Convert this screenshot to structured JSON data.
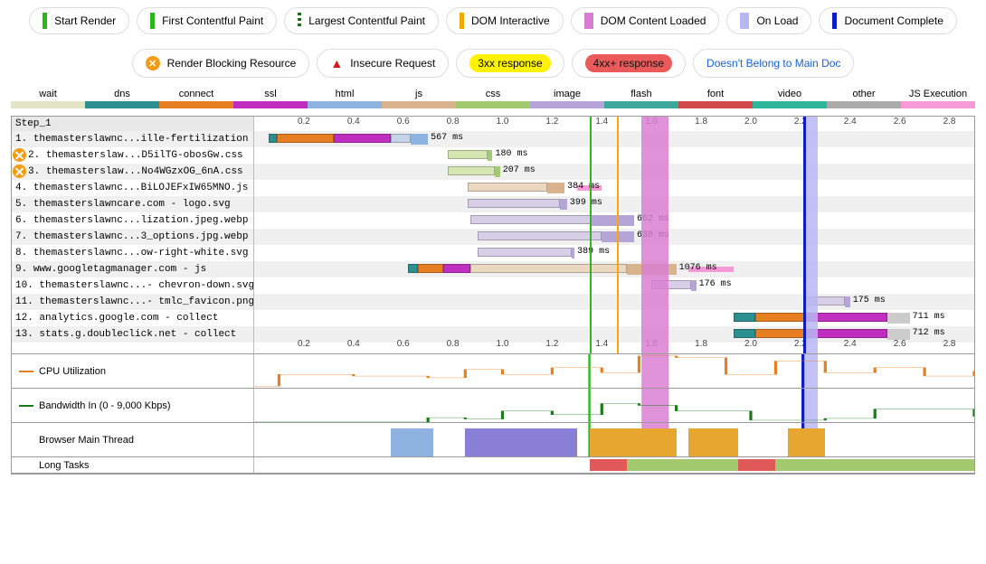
{
  "legend_timing": [
    {
      "name": "start-render",
      "label": "Start Render",
      "mark": "mark-start-render"
    },
    {
      "name": "fcp",
      "label": "First Contentful Paint",
      "mark": "mark-fcp"
    },
    {
      "name": "lcp",
      "label": "Largest Contentful Paint",
      "mark": "mark-lcp"
    },
    {
      "name": "dom-interactive",
      "label": "DOM Interactive",
      "mark": "mark-dom-int"
    },
    {
      "name": "dcl",
      "label": "DOM Content Loaded",
      "mark": "mark-dcl"
    },
    {
      "name": "onload",
      "label": "On Load",
      "mark": "mark-onload"
    },
    {
      "name": "doc-complete",
      "label": "Document Complete",
      "mark": "mark-doc"
    }
  ],
  "legend_status": {
    "render_blocking": "Render Blocking Resource",
    "insecure": "Insecure Request",
    "r3xx": "3xx response",
    "r4xx": "4xx+ response",
    "not_main": "Doesn't Belong to Main Doc"
  },
  "types": [
    {
      "label": "wait",
      "sw": "sw-wait"
    },
    {
      "label": "dns",
      "sw": "sw-dns"
    },
    {
      "label": "connect",
      "sw": "sw-connect"
    },
    {
      "label": "ssl",
      "sw": "sw-ssl"
    },
    {
      "label": "html",
      "sw": "sw-html"
    },
    {
      "label": "js",
      "sw": "sw-js"
    },
    {
      "label": "css",
      "sw": "sw-css"
    },
    {
      "label": "image",
      "sw": "sw-image"
    },
    {
      "label": "flash",
      "sw": "sw-flash"
    },
    {
      "label": "font",
      "sw": "sw-font"
    },
    {
      "label": "video",
      "sw": "sw-video"
    },
    {
      "label": "other",
      "sw": "sw-other"
    },
    {
      "label": "JS Execution",
      "sw": "sw-jse"
    }
  ],
  "step_label": "Step_1",
  "axis_ticks": [
    "0.2",
    "0.4",
    "0.6",
    "0.8",
    "1.0",
    "1.2",
    "1.4",
    "1.6",
    "1.8",
    "2.0",
    "2.2",
    "2.4",
    "2.6",
    "2.8"
  ],
  "requests": [
    {
      "n": 1,
      "label": "themasterslawnc...ille-fertilization",
      "blocking": false,
      "duration": "567 ms"
    },
    {
      "n": 2,
      "label": "themasterslaw...D5ilTG-obosGw.css",
      "blocking": true,
      "duration": "180 ms"
    },
    {
      "n": 3,
      "label": "themasterslaw...No4WGzxOG_6nA.css",
      "blocking": true,
      "duration": "207 ms"
    },
    {
      "n": 4,
      "label": "themasterslawnc...BiLOJEFxIW65MNO.js",
      "blocking": false,
      "duration": "384 ms"
    },
    {
      "n": 5,
      "label": "themasterslawncare.com - logo.svg",
      "blocking": false,
      "duration": "399 ms"
    },
    {
      "n": 6,
      "label": "themasterslawnc...lization.jpeg.webp",
      "blocking": false,
      "duration": "662 ms"
    },
    {
      "n": 7,
      "label": "themasterslawnc...3_options.jpg.webp",
      "blocking": false,
      "duration": "630 ms"
    },
    {
      "n": 8,
      "label": "themasterslawnc...ow-right-white.svg",
      "blocking": false,
      "duration": "389 ms"
    },
    {
      "n": 9,
      "label": "www.googletagmanager.com - js",
      "blocking": false,
      "duration": "1076 ms"
    },
    {
      "n": 10,
      "label": "themasterslawnc...- chevron-down.svg",
      "blocking": false,
      "duration": "176 ms"
    },
    {
      "n": 11,
      "label": "themasterslawnc...- tmlc_favicon.png",
      "blocking": false,
      "duration": "175 ms"
    },
    {
      "n": 12,
      "label": "analytics.google.com - collect",
      "blocking": false,
      "duration": "711 ms"
    },
    {
      "n": 13,
      "label": "stats.g.doubleclick.net - collect",
      "blocking": false,
      "duration": "712 ms"
    }
  ],
  "panels": {
    "cpu": "CPU Utilization",
    "bw": "Bandwidth In (0 - 9,000 Kbps)",
    "thread": "Browser Main Thread",
    "long": "Long Tasks"
  },
  "chart_data": {
    "type": "waterfall",
    "title": "",
    "x_unit": "seconds",
    "x_range": [
      0,
      2.9
    ],
    "timing_marks": {
      "start_render": 1.35,
      "first_contentful_paint": 1.35,
      "dom_interactive": 1.46,
      "dom_content_loaded": [
        1.56,
        1.67
      ],
      "on_load": [
        2.21,
        2.27
      ],
      "document_complete": 2.21
    },
    "requests": [
      {
        "n": 1,
        "name": "ille-fertilization (html)",
        "duration_ms": 567,
        "segments": [
          {
            "phase": "dns",
            "start": 0.06,
            "end": 0.09
          },
          {
            "phase": "connect",
            "start": 0.09,
            "end": 0.32
          },
          {
            "phase": "ssl",
            "start": 0.32,
            "end": 0.55
          },
          {
            "phase": "html",
            "start": 0.55,
            "end": 0.63
          },
          {
            "phase": "html_download",
            "start": 0.63,
            "end": 0.7,
            "solid": true
          }
        ]
      },
      {
        "n": 2,
        "name": "D5ilTG-obosGw.css",
        "duration_ms": 180,
        "render_blocking": true,
        "segments": [
          {
            "phase": "css",
            "start": 0.78,
            "end": 0.94
          },
          {
            "phase": "css_download",
            "start": 0.94,
            "end": 0.96,
            "solid": true
          }
        ]
      },
      {
        "n": 3,
        "name": "No4WGzxOG_6nA.css",
        "duration_ms": 207,
        "render_blocking": true,
        "segments": [
          {
            "phase": "css",
            "start": 0.78,
            "end": 0.97
          },
          {
            "phase": "css_download",
            "start": 0.97,
            "end": 0.99,
            "solid": true
          }
        ]
      },
      {
        "n": 4,
        "name": "BiLOJEFxIW65MNO.js",
        "duration_ms": 384,
        "segments": [
          {
            "phase": "js",
            "start": 0.86,
            "end": 1.18
          },
          {
            "phase": "js_download",
            "start": 1.18,
            "end": 1.25,
            "solid": true
          }
        ],
        "js_exec": [
          {
            "start": 1.3,
            "end": 1.4
          }
        ]
      },
      {
        "n": 5,
        "name": "logo.svg",
        "duration_ms": 399,
        "segments": [
          {
            "phase": "image",
            "start": 0.86,
            "end": 1.23
          },
          {
            "phase": "image_download",
            "start": 1.23,
            "end": 1.26,
            "solid": true
          }
        ]
      },
      {
        "n": 6,
        "name": "lization.jpeg.webp",
        "duration_ms": 662,
        "segments": [
          {
            "phase": "image",
            "start": 0.87,
            "end": 1.36
          },
          {
            "phase": "image_download",
            "start": 1.36,
            "end": 1.53,
            "solid": true
          }
        ]
      },
      {
        "n": 7,
        "name": "3_options.jpg.webp",
        "duration_ms": 630,
        "segments": [
          {
            "phase": "image",
            "start": 0.9,
            "end": 1.4
          },
          {
            "phase": "image_download",
            "start": 1.4,
            "end": 1.53,
            "solid": true
          }
        ]
      },
      {
        "n": 8,
        "name": "ow-right-white.svg",
        "duration_ms": 389,
        "segments": [
          {
            "phase": "image",
            "start": 0.9,
            "end": 1.28
          },
          {
            "phase": "image_download",
            "start": 1.28,
            "end": 1.29,
            "solid": true
          }
        ]
      },
      {
        "n": 9,
        "name": "googletagmanager js",
        "duration_ms": 1076,
        "segments": [
          {
            "phase": "dns",
            "start": 0.62,
            "end": 0.66
          },
          {
            "phase": "connect",
            "start": 0.66,
            "end": 0.76
          },
          {
            "phase": "ssl",
            "start": 0.76,
            "end": 0.87
          },
          {
            "phase": "js",
            "start": 0.87,
            "end": 1.5
          },
          {
            "phase": "js_download",
            "start": 1.5,
            "end": 1.7,
            "solid": true
          }
        ],
        "js_exec": [
          {
            "start": 1.75,
            "end": 1.93
          }
        ]
      },
      {
        "n": 10,
        "name": "chevron-down.svg",
        "duration_ms": 176,
        "segments": [
          {
            "phase": "image",
            "start": 1.6,
            "end": 1.76
          },
          {
            "phase": "image_download",
            "start": 1.76,
            "end": 1.78,
            "solid": true
          }
        ]
      },
      {
        "n": 11,
        "name": "tmlc_favicon.png",
        "duration_ms": 175,
        "segments": [
          {
            "phase": "image",
            "start": 2.22,
            "end": 2.38
          },
          {
            "phase": "image_download",
            "start": 2.38,
            "end": 2.4,
            "solid": true
          }
        ]
      },
      {
        "n": 12,
        "name": "analytics.google.com collect",
        "duration_ms": 711,
        "segments": [
          {
            "phase": "dns",
            "start": 1.93,
            "end": 2.02
          },
          {
            "phase": "connect",
            "start": 2.02,
            "end": 2.22
          },
          {
            "phase": "ssl",
            "start": 2.22,
            "end": 2.55
          },
          {
            "phase": "other",
            "start": 2.55,
            "end": 2.64,
            "solid": true
          }
        ]
      },
      {
        "n": 13,
        "name": "stats.g.doubleclick.net collect",
        "duration_ms": 712,
        "segments": [
          {
            "phase": "dns",
            "start": 1.93,
            "end": 2.02
          },
          {
            "phase": "connect",
            "start": 2.02,
            "end": 2.22
          },
          {
            "phase": "ssl",
            "start": 2.22,
            "end": 2.55
          },
          {
            "phase": "other",
            "start": 2.55,
            "end": 2.64,
            "solid": true
          }
        ]
      }
    ],
    "cpu_utilization_pct": {
      "x": [
        0,
        0.1,
        0.4,
        0.7,
        0.85,
        1.0,
        1.2,
        1.4,
        1.55,
        1.7,
        1.9,
        2.1,
        2.3,
        2.5,
        2.7,
        2.9
      ],
      "y": [
        5,
        40,
        35,
        30,
        55,
        40,
        60,
        45,
        95,
        90,
        40,
        80,
        45,
        60,
        35,
        50
      ]
    },
    "bandwidth_kbps": {
      "range": [
        0,
        9000
      ],
      "x": [
        0,
        0.55,
        0.7,
        0.85,
        1.0,
        1.2,
        1.4,
        1.55,
        1.7,
        2.0,
        2.3,
        2.5,
        2.9
      ],
      "y": [
        0,
        0,
        1200,
        800,
        3000,
        2000,
        5000,
        4500,
        3000,
        500,
        1000,
        3500,
        1500
      ]
    },
    "main_thread_busy": [
      {
        "start": 0.55,
        "end": 0.72,
        "color": "#8fb3e0"
      },
      {
        "start": 0.85,
        "end": 1.3,
        "color": "#8a7fd6"
      },
      {
        "start": 1.35,
        "end": 1.7,
        "color": "#e6a62f"
      },
      {
        "start": 1.75,
        "end": 1.95,
        "color": "#e6a62f"
      },
      {
        "start": 2.15,
        "end": 2.3,
        "color": "#e6a62f"
      }
    ],
    "long_tasks": [
      {
        "start": 1.35,
        "end": 1.5,
        "color": "#e05a5a"
      },
      {
        "start": 1.5,
        "end": 1.95,
        "color": "#a3c96e"
      },
      {
        "start": 1.95,
        "end": 2.1,
        "color": "#e05a5a"
      },
      {
        "start": 2.1,
        "end": 2.9,
        "color": "#a3c96e"
      }
    ]
  }
}
